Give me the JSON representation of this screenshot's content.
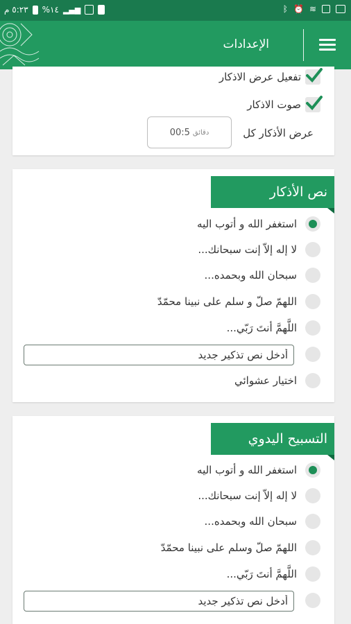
{
  "status_bar": {
    "time": "٥:٢٣ م",
    "battery": "%١٤"
  },
  "appbar": {
    "title": "الإعدادات"
  },
  "display_settings": {
    "enable_label": "تفعيل عرض الاذكار",
    "sound_label": "صوت الاذكار",
    "interval_label": "عرض الأذكار كل",
    "interval_value": "00:5",
    "interval_unit": "دقائق"
  },
  "azkar_text": {
    "title": "نص الأذكار",
    "options": [
      "استغفر الله و أتوب اليه",
      "لا إله إلاّ إنت سبحانك...",
      "سبحان الله وبحمده...",
      "اللهمّ صلّ و سلم على نبينا محمّدّ",
      "اللَّهمَّ أنتَ رَبّي...",
      "",
      "اختيار عشوائي"
    ],
    "custom_placeholder": "أدخل نص تذكير جديد"
  },
  "manual_tasbeeh": {
    "title": "التسبيح اليدوي",
    "options": [
      "استغفر الله و أتوب اليه",
      "لا إله إلاّ إنت سبحانك...",
      "سبحان الله وبحمده...",
      "اللهمّ صلّ وسلم على نبينا محمّدّ",
      "اللَّهمَّ أنتَ رَبّي...",
      ""
    ],
    "custom_placeholder": "أدخل نص تذكير جديد"
  },
  "colors": {
    "primary": "#229a60",
    "status_bar": "#1a7a4e",
    "accent": "#1d8f57"
  }
}
